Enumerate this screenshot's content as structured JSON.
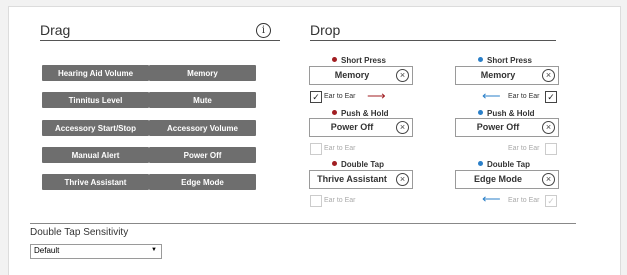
{
  "colors": {
    "dot_left": "#a11e22",
    "dot_right": "#2a7fc8",
    "arrow_left": "#a11e22",
    "arrow_right": "#2a7fc8",
    "button_bg": "#6e6e6e"
  },
  "drag": {
    "title": "Drag",
    "info_icon": "info-icon",
    "buttons": [
      "Hearing Aid Volume",
      "Memory",
      "Tinnitus Level",
      "Mute",
      "Accessory Start/Stop",
      "Accessory Volume",
      "Manual Alert",
      "Power Off",
      "Thrive Assistant",
      "Edge Mode"
    ]
  },
  "drop": {
    "title": "Drop",
    "ear_to_ear": "Ear to Ear",
    "rows": [
      {
        "left": {
          "label": "Short Press",
          "value": "Memory"
        },
        "right": {
          "label": "Short Press",
          "value": "Memory"
        },
        "ear_left_checked": true,
        "ear_left_enabled": true,
        "ear_right_checked": true,
        "ear_right_enabled": true
      },
      {
        "left": {
          "label": "Push & Hold",
          "value": "Power Off"
        },
        "right": {
          "label": "Push & Hold",
          "value": "Power Off"
        },
        "ear_left_checked": false,
        "ear_left_enabled": false,
        "ear_right_checked": false,
        "ear_right_enabled": false
      },
      {
        "left": {
          "label": "Double Tap",
          "value": "Thrive Assistant"
        },
        "right": {
          "label": "Double Tap",
          "value": "Edge Mode"
        },
        "ear_left_checked": false,
        "ear_left_enabled": false,
        "ear_right_checked": true,
        "ear_right_enabled": false
      }
    ]
  },
  "sensitivity": {
    "label": "Double Tap Sensitivity",
    "value": "Default"
  }
}
